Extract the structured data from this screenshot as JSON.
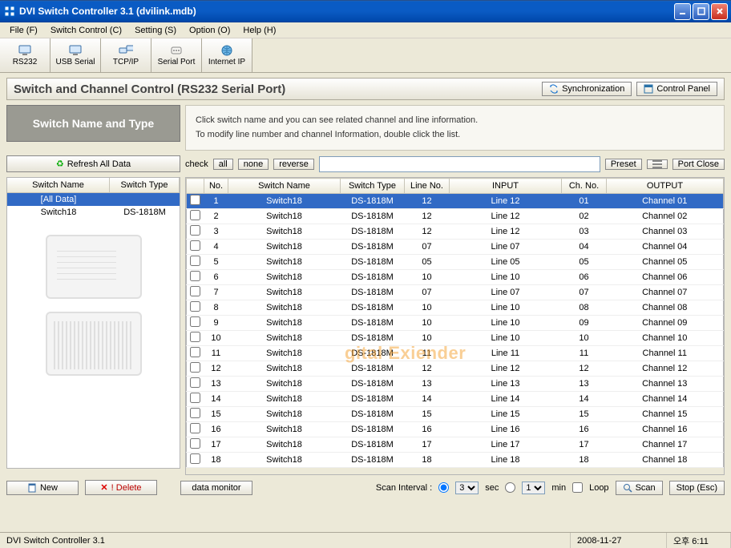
{
  "window": {
    "title": "DVI Switch Controller 3.1   (dvilink.mdb)"
  },
  "menu": {
    "file": "File (F)",
    "switch_control": "Switch Control (C)",
    "setting": "Setting (S)",
    "option": "Option (O)",
    "help": "Help (H)"
  },
  "toolbar": {
    "rs232": "RS232",
    "usb_serial": "USB Serial",
    "tcpip": "TCP/IP",
    "serial_port": "Serial Port",
    "internet_ip": "Internet IP"
  },
  "panel": {
    "title": "Switch and Channel Control (RS232 Serial Port)",
    "sync": "Synchronization",
    "control_panel": "Control Panel",
    "name_type": "Switch Name and Type",
    "instruction_line1": "Click switch name and you can see related channel and line information.",
    "instruction_line2": "To modify line number and channel Information, double click the list.",
    "refresh": "Refresh All Data"
  },
  "check_row": {
    "label": "check",
    "all": "all",
    "none": "none",
    "reverse": "reverse",
    "preset": "Preset",
    "port_close": "Port Close"
  },
  "switch_list": {
    "header_name": "Switch Name",
    "header_type": "Switch Type",
    "rows": [
      {
        "name": "[All Data]",
        "type": "",
        "selected": true
      },
      {
        "name": "Switch18",
        "type": "DS-1818M",
        "selected": false
      }
    ]
  },
  "main_headers": {
    "no": "No.",
    "switch_name": "Switch Name",
    "switch_type": "Switch Type",
    "line_no": "Line No.",
    "input": "INPUT",
    "ch_no": "Ch. No.",
    "output": "OUTPUT"
  },
  "rows": [
    {
      "no": "1",
      "sn": "Switch18",
      "st": "DS-1818M",
      "ln": "12",
      "in": "Line 12",
      "cn": "01",
      "out": "Channel 01",
      "sel": true
    },
    {
      "no": "2",
      "sn": "Switch18",
      "st": "DS-1818M",
      "ln": "12",
      "in": "Line 12",
      "cn": "02",
      "out": "Channel 02"
    },
    {
      "no": "3",
      "sn": "Switch18",
      "st": "DS-1818M",
      "ln": "12",
      "in": "Line 12",
      "cn": "03",
      "out": "Channel 03"
    },
    {
      "no": "4",
      "sn": "Switch18",
      "st": "DS-1818M",
      "ln": "07",
      "in": "Line 07",
      "cn": "04",
      "out": "Channel 04"
    },
    {
      "no": "5",
      "sn": "Switch18",
      "st": "DS-1818M",
      "ln": "05",
      "in": "Line 05",
      "cn": "05",
      "out": "Channel 05"
    },
    {
      "no": "6",
      "sn": "Switch18",
      "st": "DS-1818M",
      "ln": "10",
      "in": "Line 10",
      "cn": "06",
      "out": "Channel 06"
    },
    {
      "no": "7",
      "sn": "Switch18",
      "st": "DS-1818M",
      "ln": "07",
      "in": "Line 07",
      "cn": "07",
      "out": "Channel 07"
    },
    {
      "no": "8",
      "sn": "Switch18",
      "st": "DS-1818M",
      "ln": "10",
      "in": "Line 10",
      "cn": "08",
      "out": "Channel 08"
    },
    {
      "no": "9",
      "sn": "Switch18",
      "st": "DS-1818M",
      "ln": "10",
      "in": "Line 10",
      "cn": "09",
      "out": "Channel 09"
    },
    {
      "no": "10",
      "sn": "Switch18",
      "st": "DS-1818M",
      "ln": "10",
      "in": "Line 10",
      "cn": "10",
      "out": "Channel 10"
    },
    {
      "no": "11",
      "sn": "Switch18",
      "st": "DS-1818M",
      "ln": "11",
      "in": "Line 11",
      "cn": "11",
      "out": "Channel 11"
    },
    {
      "no": "12",
      "sn": "Switch18",
      "st": "DS-1818M",
      "ln": "12",
      "in": "Line 12",
      "cn": "12",
      "out": "Channel 12"
    },
    {
      "no": "13",
      "sn": "Switch18",
      "st": "DS-1818M",
      "ln": "13",
      "in": "Line 13",
      "cn": "13",
      "out": "Channel 13"
    },
    {
      "no": "14",
      "sn": "Switch18",
      "st": "DS-1818M",
      "ln": "14",
      "in": "Line 14",
      "cn": "14",
      "out": "Channel 14"
    },
    {
      "no": "15",
      "sn": "Switch18",
      "st": "DS-1818M",
      "ln": "15",
      "in": "Line 15",
      "cn": "15",
      "out": "Channel 15"
    },
    {
      "no": "16",
      "sn": "Switch18",
      "st": "DS-1818M",
      "ln": "16",
      "in": "Line 16",
      "cn": "16",
      "out": "Channel 16"
    },
    {
      "no": "17",
      "sn": "Switch18",
      "st": "DS-1818M",
      "ln": "17",
      "in": "Line 17",
      "cn": "17",
      "out": "Channel 17"
    },
    {
      "no": "18",
      "sn": "Switch18",
      "st": "DS-1818M",
      "ln": "18",
      "in": "Line 18",
      "cn": "18",
      "out": "Channel 18"
    }
  ],
  "bottom": {
    "new": "New",
    "delete": "! Delete",
    "data_monitor": "data monitor",
    "scan_interval_label": "Scan Interval :",
    "sec_value": "3",
    "sec_label": "sec",
    "min_value": "1",
    "min_label": "min",
    "loop": "Loop",
    "scan": "Scan",
    "stop": "Stop (Esc)"
  },
  "status": {
    "app": "DVI Switch Controller 3.1",
    "date": "2008-11-27",
    "time": "오후 6:11"
  },
  "watermark": "gital Exiender"
}
